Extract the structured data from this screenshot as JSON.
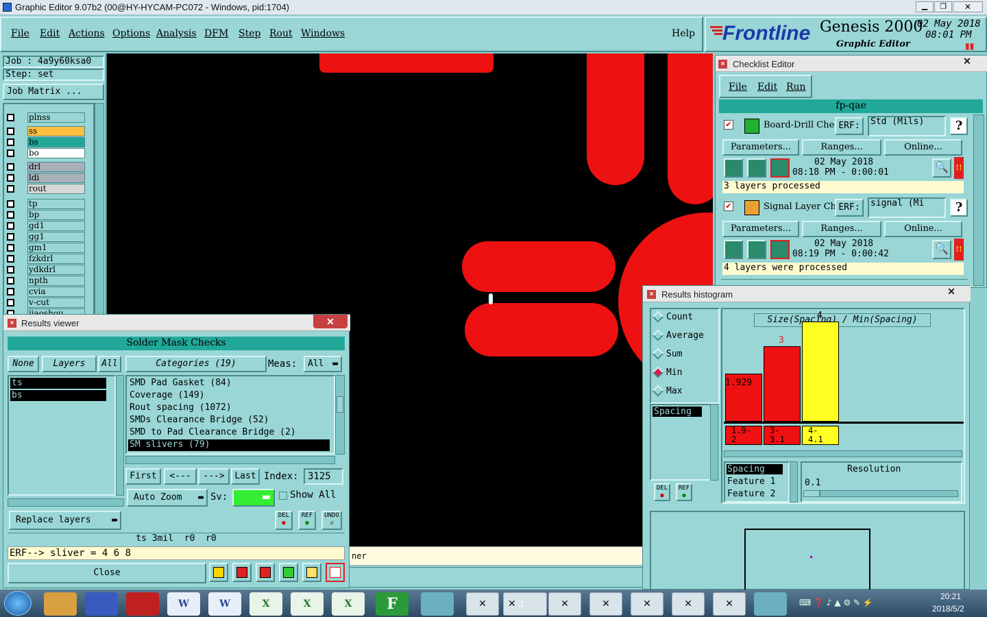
{
  "titlebar": {
    "title": "Graphic Editor 9.07b2 (00@HY-HYCAM-PC072 - Windows, pid:1704)"
  },
  "menu": {
    "items": [
      "File",
      "Edit",
      "Actions",
      "Options",
      "Analysis",
      "DFM",
      "Step",
      "Rout",
      "Windows"
    ],
    "help": "Help"
  },
  "brand": {
    "logo": "Frontline",
    "product": "Genesis 2000",
    "subtitle": "Graphic Editor",
    "date": "02 May 2018",
    "time": "08:01 PM"
  },
  "job": {
    "job": "Job : 4a9y60ksa0",
    "step": "Step: set",
    "matrix": "Job Matrix ..."
  },
  "layers": [
    "plnss",
    "ss",
    "bs",
    "bo",
    "drl",
    "ldi",
    "rout",
    "tp",
    "bp",
    "gd1",
    "gg1",
    "gm1",
    "fzkdrl",
    "ydkdrl",
    "npth",
    "cvia",
    "v-cut",
    "jiaoshou"
  ],
  "status_bar": {
    "text": "ner"
  },
  "checklist": {
    "title": "Checklist Editor",
    "menu": [
      "File",
      "Edit",
      "Run"
    ],
    "name": "fp-qae",
    "actions": [
      {
        "name": "Board-Drill Che",
        "erf": "ERF:",
        "erf_value": "Std (Mils)",
        "params": "Parameters...",
        "ranges": "Ranges...",
        "online": "Online...",
        "date": "02 May 2018",
        "time": "08:18 PM - 0:00:01",
        "status": "3 layers processed"
      },
      {
        "name": "Signal Layer Ch",
        "erf": "ERF:",
        "erf_value": "signal (Mi",
        "params": "Parameters...",
        "ranges": "Ranges...",
        "online": "Online...",
        "date": "02 May 2018",
        "time": "08:19 PM - 0:00:42",
        "status": "4 layers were processed"
      }
    ],
    "help_glyph": "?"
  },
  "histogram": {
    "title": "Results histogram",
    "modes": [
      "Count",
      "Average",
      "Sum",
      "Min",
      "Max"
    ],
    "selected_mode": "Min",
    "measure": "Spacing",
    "chart_title": "Size(Spacing) / Min(Spacing)",
    "bars": [
      {
        "label": "1.929",
        "range": "1.9-\n2",
        "value": 1.929,
        "color": "#ee1111"
      },
      {
        "label": "3",
        "range": "3-\n3.1",
        "value": 3,
        "color": "#ee1111"
      },
      {
        "label": "4",
        "range": "4-\n4.1",
        "value": 4,
        "color": "#ffff22"
      }
    ],
    "list": [
      "Spacing",
      "Feature 1",
      "Feature 2"
    ],
    "resolution_label": "Resolution",
    "resolution_value": "0.1",
    "del": "DEL",
    "ref": "REF"
  },
  "results": {
    "title": "Results viewer",
    "header": "Solder Mask Checks",
    "none": "None",
    "layers_label": "Layers",
    "all": "All",
    "categories_label": "Categories (19)",
    "meas_label": "Meas:",
    "meas_value": "All",
    "layer_list": [
      "ts",
      "bs"
    ],
    "categories": [
      "SMD Pad Gasket (84)",
      "Coverage (149)",
      "Rout spacing (1072)",
      "SMDs Clearance Bridge (52)",
      "SMD to Pad Clearance Bridge (2)",
      "SM slivers (79)"
    ],
    "nav": {
      "first": "First",
      "prev": "<---",
      "next": "--->",
      "last": "Last",
      "index_label": "Index:",
      "index_value": "3125"
    },
    "auto_zoom": "Auto Zoom",
    "sv_label": "Sv:",
    "show_all": "Show All",
    "replace_layers": "Replace layers",
    "del": "DEL",
    "ref": "REF",
    "undo": "UNDO",
    "info": "ts 3mil  r0  r0",
    "erf_line": "ERF--> sliver = 4 6 8",
    "close": "Close"
  },
  "taskbar": {
    "time": "20:21",
    "date": "2018/5/2",
    "item_label": "J..."
  },
  "colors": {
    "teal": "#9ad6d6",
    "dark_teal": "#22a898",
    "red": "#ee1111",
    "yellow": "#ffff22",
    "canvas": "#000000"
  }
}
